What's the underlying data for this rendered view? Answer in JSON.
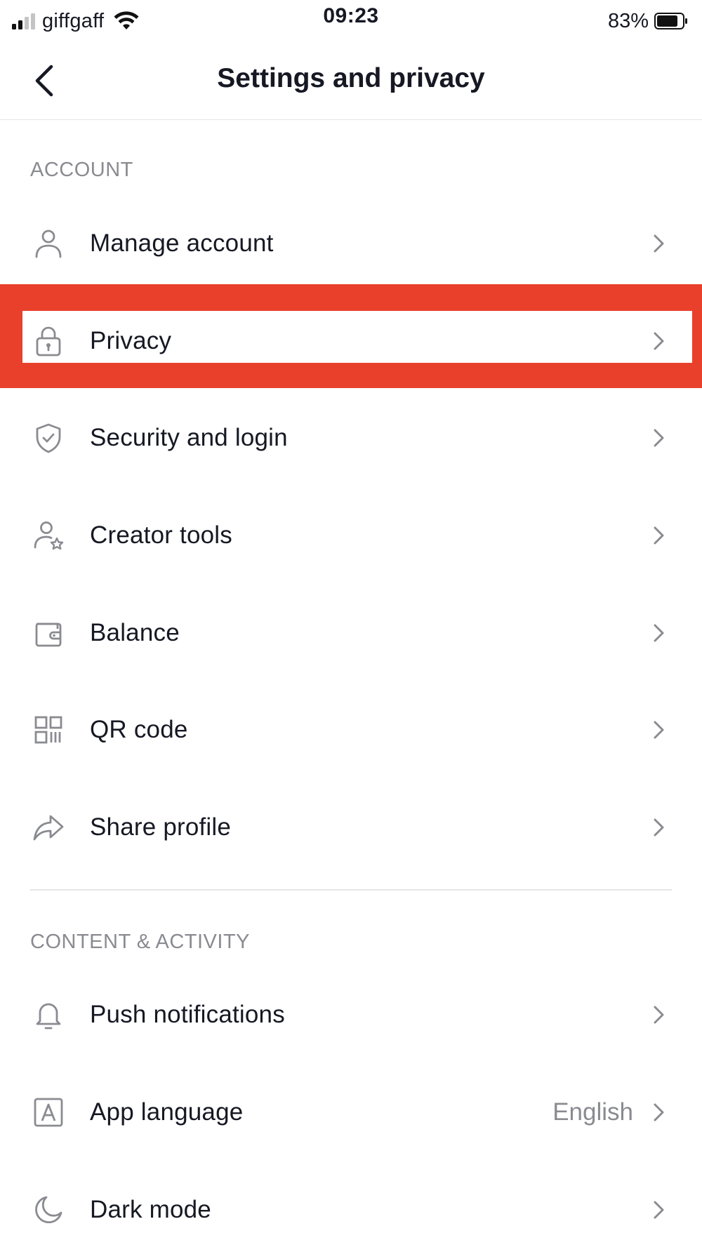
{
  "status_bar": {
    "carrier": "giffgaff",
    "time": "09:23",
    "battery_percent": "83%",
    "battery_level": 0.83,
    "signal_bars_filled": 2,
    "signal_bars_total": 4
  },
  "header": {
    "title": "Settings and privacy",
    "back_icon": "chevron-left-icon"
  },
  "sections": [
    {
      "header": "ACCOUNT",
      "items": [
        {
          "label": "Manage account",
          "icon": "person-icon"
        },
        {
          "label": "Privacy",
          "icon": "lock-icon",
          "highlighted": true
        },
        {
          "label": "Security and login",
          "icon": "shield-check-icon"
        },
        {
          "label": "Creator tools",
          "icon": "person-star-icon"
        },
        {
          "label": "Balance",
          "icon": "wallet-icon"
        },
        {
          "label": "QR code",
          "icon": "qr-code-icon"
        },
        {
          "label": "Share profile",
          "icon": "share-arrow-icon"
        }
      ]
    },
    {
      "header": "CONTENT & ACTIVITY",
      "items": [
        {
          "label": "Push notifications",
          "icon": "bell-icon"
        },
        {
          "label": "App language",
          "icon": "language-a-icon",
          "value": "English"
        },
        {
          "label": "Dark mode",
          "icon": "moon-icon"
        }
      ]
    }
  ],
  "colors": {
    "highlight_box": "#e8402a",
    "text_primary": "#161823",
    "text_secondary": "#8a8b91",
    "divider": "#e6e6e6"
  }
}
